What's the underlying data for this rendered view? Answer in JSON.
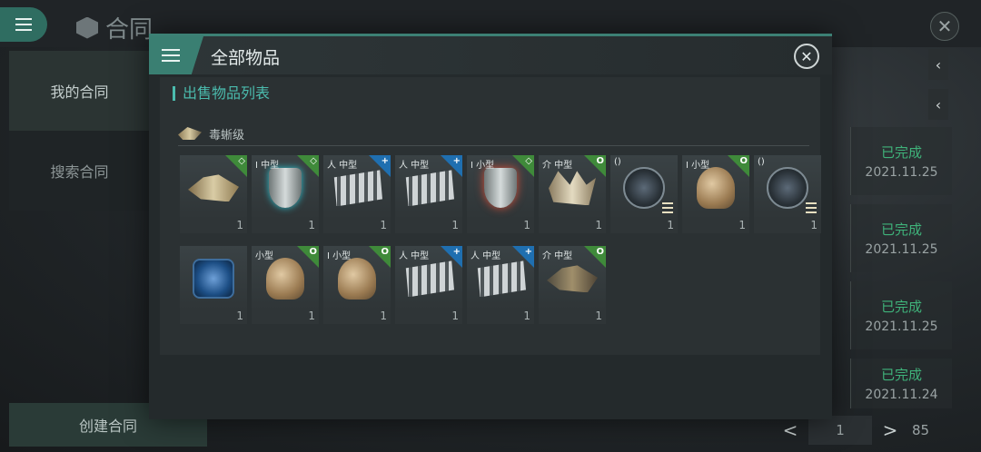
{
  "background": {
    "title": "合同",
    "sidebar": [
      "我的合同",
      "搜索合同"
    ],
    "create_button": "创建合同",
    "statuses": [
      {
        "status": "已完成",
        "date": "2021.11.25"
      },
      {
        "status": "已完成",
        "date": "2021.11.25"
      },
      {
        "status": "已完成",
        "date": "2021.11.25"
      },
      {
        "status": "已完成",
        "date": "2021.11.24"
      }
    ],
    "pager": {
      "current": "1",
      "total": "85",
      "prev": "<",
      "next": ">"
    }
  },
  "modal": {
    "title": "全部物品",
    "section_title": "出售物品列表",
    "ship_class": "毒蜥级",
    "rows": [
      [
        {
          "art": "ship",
          "size": "",
          "badge": "green",
          "symbol": "◇",
          "qty": "1"
        },
        {
          "art": "shield",
          "size": "I 中型",
          "badge": "green",
          "symbol": "◇",
          "qty": "1"
        },
        {
          "art": "launcher",
          "size": "人 中型",
          "badge": "blue",
          "symbol": "+",
          "qty": "1"
        },
        {
          "art": "launcher",
          "size": "人 中型",
          "badge": "blue",
          "symbol": "+",
          "qty": "1"
        },
        {
          "art": "shield-red",
          "size": "I 小型",
          "badge": "green",
          "symbol": "◇",
          "qty": "1"
        },
        {
          "art": "claw",
          "size": "介 中型",
          "badge": "green",
          "symbol": "O",
          "qty": "1"
        },
        {
          "art": "drone",
          "size": "()",
          "badge": "",
          "symbol": "",
          "qty": "1"
        },
        {
          "art": "dish",
          "size": "I 小型",
          "badge": "green",
          "symbol": "O",
          "qty": "1"
        },
        {
          "art": "drone",
          "size": "()",
          "badge": "",
          "symbol": "",
          "qty": "1"
        }
      ],
      [
        {
          "art": "crystal",
          "size": "",
          "badge": "",
          "symbol": "",
          "qty": "1"
        },
        {
          "art": "dish",
          "size": "小型",
          "badge": "green",
          "symbol": "O",
          "qty": "1"
        },
        {
          "art": "dish",
          "size": "I 小型",
          "badge": "green",
          "symbol": "O",
          "qty": "1"
        },
        {
          "art": "launcher",
          "size": "人 中型",
          "badge": "blue",
          "symbol": "+",
          "qty": "1"
        },
        {
          "art": "launcher",
          "size": "人 中型",
          "badge": "blue",
          "symbol": "+",
          "qty": "1"
        },
        {
          "art": "ship-dark",
          "size": "介 中型",
          "badge": "green",
          "symbol": "O",
          "qty": "1"
        }
      ]
    ]
  },
  "colors": {
    "accent": "#3a7f72",
    "green_badge": "#3f8a3a",
    "blue_badge": "#1f6fb0",
    "done": "#3fb27a"
  }
}
